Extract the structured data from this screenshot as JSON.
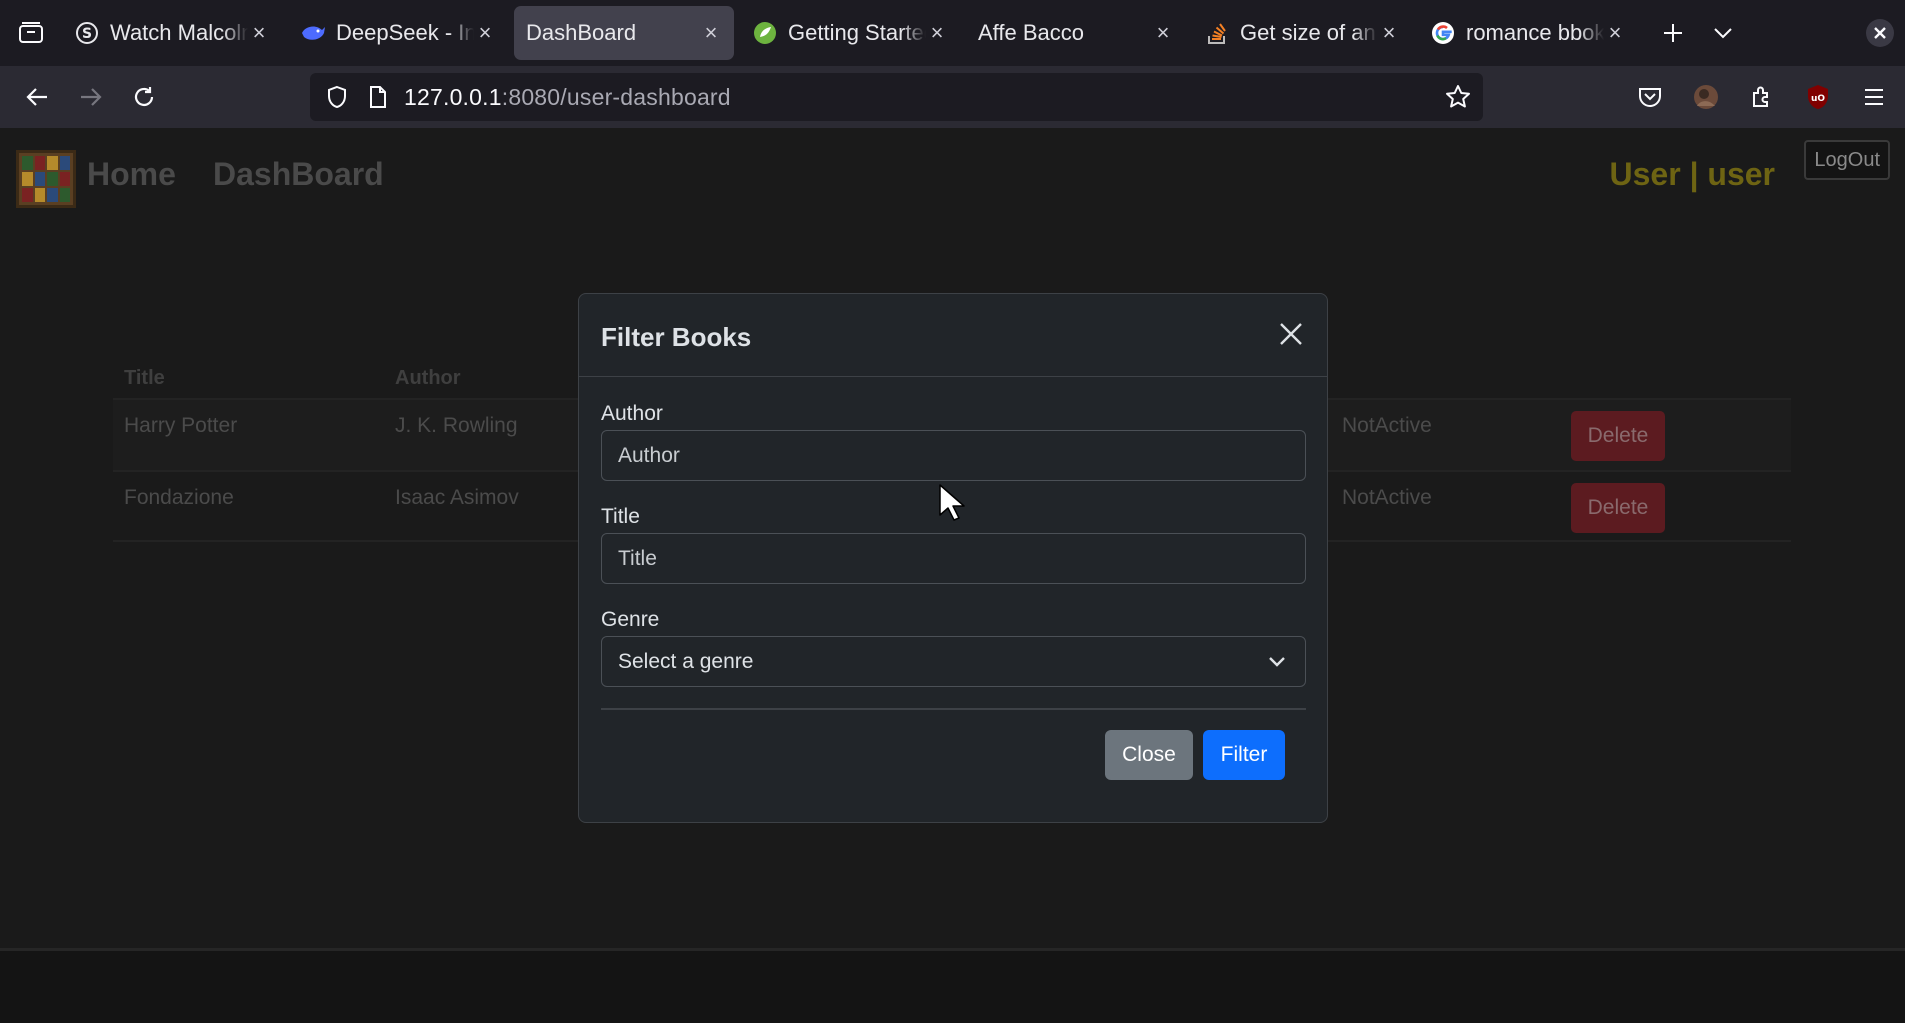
{
  "browser": {
    "tabs": [
      {
        "title": "Watch Malcolm",
        "icon": "s-logo-icon",
        "active": false
      },
      {
        "title": "DeepSeek - Int",
        "icon": "deepseek-whale-icon",
        "active": false
      },
      {
        "title": "DashBoard",
        "icon": "",
        "active": true
      },
      {
        "title": "Getting Started",
        "icon": "spring-leaf-icon",
        "active": false
      },
      {
        "title": "Affe Bacco",
        "icon": "",
        "active": false
      },
      {
        "title": "Get size of an",
        "icon": "stackoverflow-icon",
        "active": false
      },
      {
        "title": "romance bbok",
        "icon": "google-g-icon",
        "active": false
      }
    ],
    "url_host": "127.0.0.1",
    "url_rest": ":8080/user-dashboard"
  },
  "header": {
    "home_label": "Home",
    "dashboard_label": "DashBoard",
    "user_label": "User | user",
    "logout_label": "LogOut"
  },
  "table": {
    "columns": [
      "Title",
      "Author"
    ],
    "rows": [
      {
        "title": "Harry Potter",
        "author": "J. K. Rowling",
        "status": "NotActive",
        "action": "Delete"
      },
      {
        "title": "Fondazione",
        "author": "Isaac Asimov",
        "status": "NotActive",
        "action": "Delete"
      }
    ]
  },
  "modal": {
    "title": "Filter Books",
    "author_label": "Author",
    "author_placeholder": "Author",
    "title_label": "Title",
    "title_placeholder": "Title",
    "genre_label": "Genre",
    "genre_selected": "Select a genre",
    "close_label": "Close",
    "filter_label": "Filter"
  },
  "colors": {
    "primary": "#0d6efd",
    "secondary": "#6c757d",
    "danger_dimmed": "#5c1b20",
    "user_label": "#6e6413"
  }
}
